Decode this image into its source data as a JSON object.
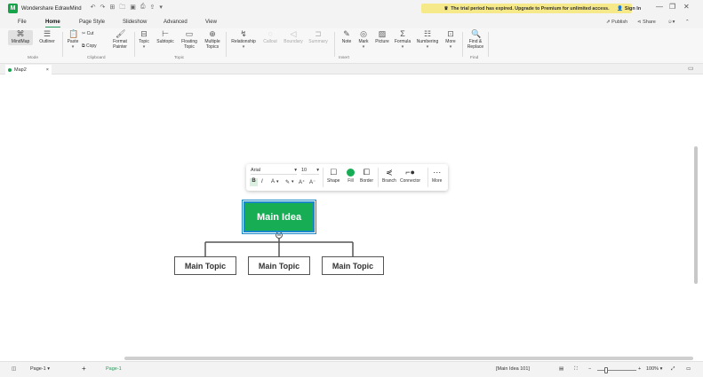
{
  "app": {
    "name": "Wondershare EdrawMind",
    "logo_letter": "M"
  },
  "banner": {
    "trial_text": "The trial period has expired. Upgrade to Premium for unlimited access."
  },
  "account": {
    "sign_in": "Sign In"
  },
  "menu": {
    "tabs": [
      "File",
      "Home",
      "Page Style",
      "Slideshow",
      "Advanced",
      "View"
    ],
    "active": "Home",
    "publish": "Publish",
    "share": "Share"
  },
  "ribbon": {
    "mode": {
      "mindmap": "MindMap",
      "outliner": "Outliner",
      "label": "Mode"
    },
    "clipboard": {
      "paste": "Paste",
      "cut": "Cut",
      "copy": "Copy",
      "format_painter_1": "Format",
      "format_painter_2": "Painter",
      "label": "Clipboard"
    },
    "topic": {
      "topic": "Topic",
      "subtopic": "Subtopic",
      "floating_1": "Floating",
      "floating_2": "Topic",
      "multiple_1": "Multiple",
      "multiple_2": "Topics",
      "label": "Topic"
    },
    "relation": {
      "relationship": "Relationship",
      "callout": "Callout",
      "boundary": "Boundary",
      "summary": "Summary"
    },
    "insert": {
      "note": "Note",
      "mark": "Mark",
      "picture": "Picture",
      "formula": "Formula",
      "numbering": "Numbering",
      "more": "More",
      "label": "Insert"
    },
    "find": {
      "find_1": "Find &",
      "find_2": "Replace",
      "label": "Find"
    }
  },
  "document": {
    "tab": "Map2"
  },
  "floating_toolbar": {
    "font": "Arial",
    "size": "10",
    "bold": "B",
    "italic": "I",
    "font_color": "A",
    "highlight": "✎",
    "grow": "A⁺",
    "shrink": "A⁻",
    "shape": "Shape",
    "fill": "Fill",
    "border": "Border",
    "branch": "Branch",
    "connector": "Connector",
    "more": "More",
    "fill_color": "#17ad55"
  },
  "mindmap": {
    "main_idea": "Main Idea",
    "topics": [
      "Main Topic",
      "Main Topic",
      "Main Topic"
    ],
    "main_color": "#17ad55",
    "selection_color": "#1a88c9"
  },
  "status": {
    "page_select": "Page-1",
    "page_tab": "Page-1",
    "selection": "[Main Idea 101]",
    "zoom": "100%"
  }
}
